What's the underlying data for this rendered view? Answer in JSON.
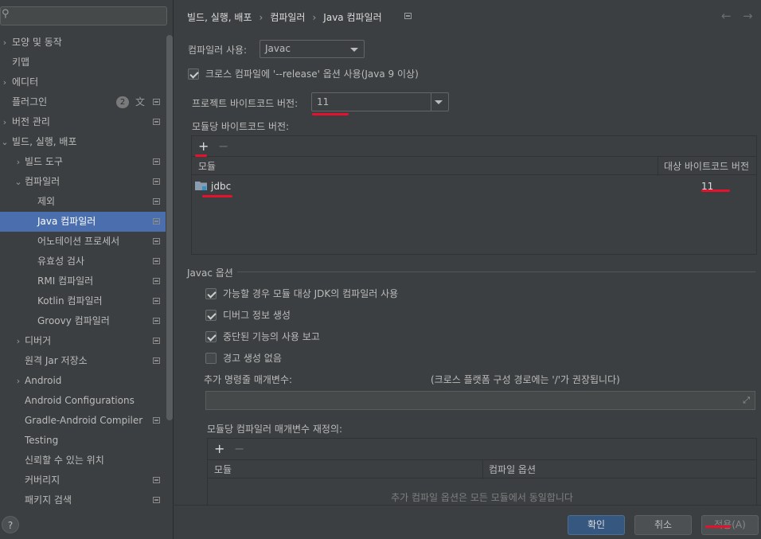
{
  "sidebar": {
    "search_placeholder": "",
    "items": [
      {
        "label": "모양 및 동작",
        "arrow": "›"
      },
      {
        "label": "키맵"
      },
      {
        "label": "에디터",
        "arrow": "›"
      },
      {
        "label": "플러그인",
        "badge": "2"
      },
      {
        "label": "버전 관리",
        "arrow": "›"
      },
      {
        "label": "빌드, 실행, 배포",
        "arrow": "⌄"
      },
      {
        "label": "빌드 도구",
        "arrow": "›"
      },
      {
        "label": "컴파일러",
        "arrow": "⌄"
      },
      {
        "label": "제외"
      },
      {
        "label": "Java 컴파일러",
        "selected": true
      },
      {
        "label": "어노테이션 프로세서"
      },
      {
        "label": "유효성 검사"
      },
      {
        "label": "RMI 컴파일러"
      },
      {
        "label": "Kotlin 컴파일러"
      },
      {
        "label": "Groovy 컴파일러"
      },
      {
        "label": "디버거",
        "arrow": "›"
      },
      {
        "label": "원격 Jar 저장소"
      },
      {
        "label": "Android",
        "arrow": "›"
      },
      {
        "label": "Android Configurations"
      },
      {
        "label": "Gradle-Android Compiler"
      },
      {
        "label": "Testing"
      },
      {
        "label": "신뢰할 수 있는 위치"
      },
      {
        "label": "커버리지"
      },
      {
        "label": "패키지 검색"
      }
    ]
  },
  "header": {
    "crumb1": "빌드, 실행, 배포",
    "crumb2": "컴파일러",
    "crumb3": "Java 컴파일러",
    "separator": "›",
    "back": "←",
    "forward": "→"
  },
  "compiler": {
    "use_label": "컴파일러 사용:",
    "use_value": "Javac",
    "release_label": "크로스 컴파일에 '--release' 옵션 사용(Java 9 이상)",
    "project_bytecode_label": "프로젝트 바이트코드 버전:",
    "project_bytecode_value": "11",
    "per_module_label": "모듈당 바이트코드 버전:",
    "add": "+",
    "remove": "−",
    "columns": {
      "module": "모듈",
      "target": "대상 바이트코드 버전"
    },
    "rows": [
      {
        "module": "jdbc",
        "target": "11"
      }
    ]
  },
  "javac": {
    "section_title": "Javac 옵션",
    "options": [
      {
        "label": "가능할 경우 모듈 대상 JDK의 컴파일러 사용",
        "checked": true
      },
      {
        "label": "디버그 정보 생성",
        "checked": true
      },
      {
        "label": "중단된 기능의 사용 보고",
        "checked": true
      },
      {
        "label": "경고 생성 없음",
        "checked": false
      }
    ],
    "args_label": "추가 명령줄 매개변수:",
    "args_hint": "(크로스 플랫폼 구성 경로에는 '/'가 권장됩니다)",
    "args_value": "",
    "override_label": "모듈당 컴파일러 매개변수 재정의:",
    "override_columns": {
      "module": "모듈",
      "options": "컴파일 옵션"
    },
    "override_empty": "추가 컴파일 옵션은 모든 모듈에서 동일합니다"
  },
  "buttons": {
    "ok": "확인",
    "cancel": "취소",
    "apply": "적용(A)",
    "help": "?"
  },
  "colors": {
    "selection": "#4b6eaf",
    "primary_button": "#365880",
    "annotation": "#e8112d"
  }
}
